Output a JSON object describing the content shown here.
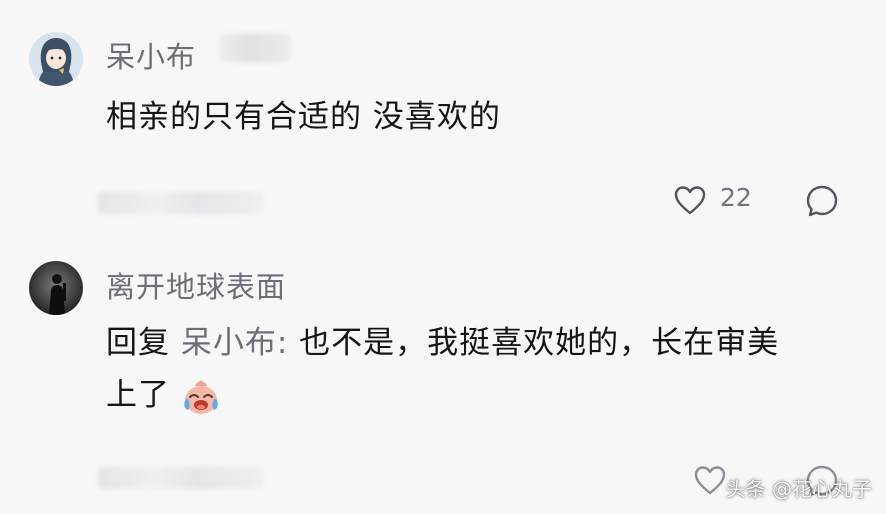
{
  "comments": [
    {
      "username": "呆小布",
      "text": "相亲的只有合适的 没喜欢的",
      "likes": "22"
    },
    {
      "username": "离开地球表面",
      "reply_prefix": "回复",
      "reply_to": "呆小布",
      "reply_colon": ":",
      "text_line1": "也不是，我挺喜欢她的，长在审美",
      "text_line2": "上了"
    }
  ],
  "watermark": "头条 @花心丸子",
  "icons": [
    "heart-icon",
    "comment-bubble-icon",
    "crying-laughing-emoji"
  ]
}
